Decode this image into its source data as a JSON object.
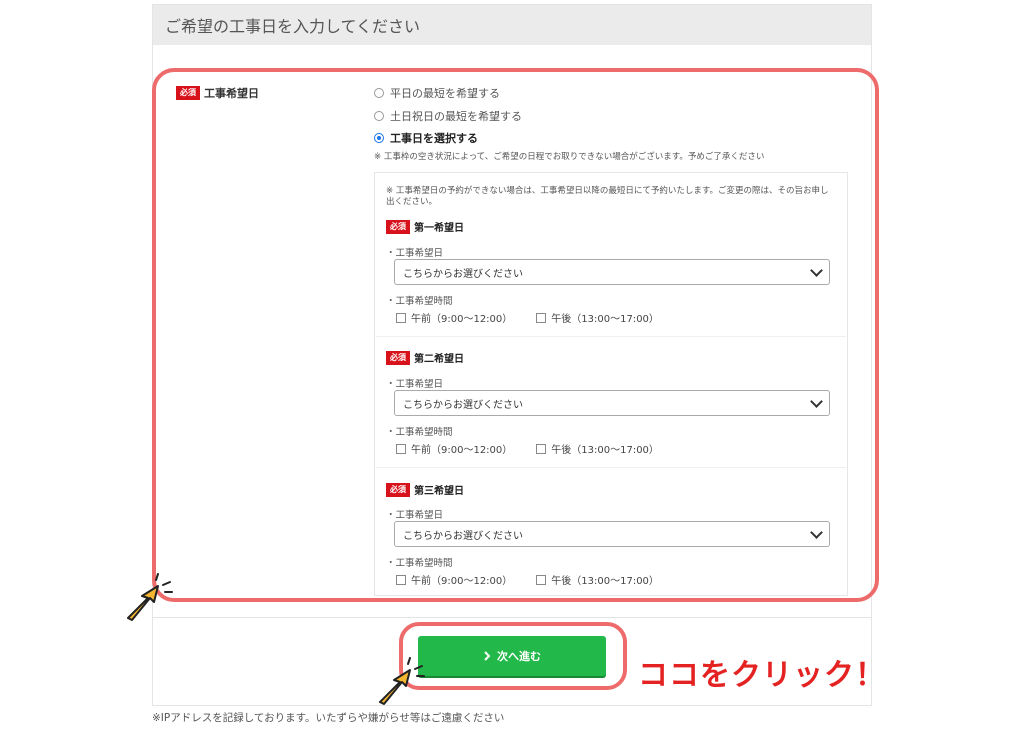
{
  "panel": {
    "title": "ご希望の工事日を入力してください"
  },
  "field": {
    "badge": "必須",
    "label": "工事希望日"
  },
  "options": {
    "weekday": "平日の最短を希望する",
    "weekend": "土日祝日の最短を希望する",
    "select_day": "工事日を選択する",
    "selected": "select_day"
  },
  "note": "※ 工事枠の空き状況によって、ご希望の日程でお取りできない場合がございます。予めご了承ください",
  "inner_note": "※ 工事希望日の予約ができない場合は、工事希望日以降の最短日にて予約いたします。ご変更の際は、その旨お申し出ください。",
  "preferences": [
    {
      "badge": "必須",
      "title": "第一希望日",
      "date_label": "・工事希望日",
      "date_placeholder": "こちらからお選びください",
      "time_label": "・工事希望時間",
      "am": "午前（9:00〜12:00）",
      "pm": "午後（13:00〜17:00）"
    },
    {
      "badge": "必須",
      "title": "第二希望日",
      "date_label": "・工事希望日",
      "date_placeholder": "こちらからお選びください",
      "time_label": "・工事希望時間",
      "am": "午前（9:00〜12:00）",
      "pm": "午後（13:00〜17:00）"
    },
    {
      "badge": "必須",
      "title": "第三希望日",
      "date_label": "・工事希望日",
      "date_placeholder": "こちらからお選びください",
      "time_label": "・工事希望時間",
      "am": "午前（9:00〜12:00）",
      "pm": "午後（13:00〜17:00）"
    }
  ],
  "next_button": {
    "label": "次へ進む",
    "icon": "chevron-right-icon",
    "color": "#22b84a"
  },
  "callout": "ココをクリック！",
  "footer": "※IPアドレスを記録しております。いたずらや嫌がらせ等はご遠慮ください",
  "colors": {
    "highlight": "#ee6b6b",
    "badge": "#d7121b",
    "callout": "#e52222",
    "pointer": "#f5b731"
  }
}
